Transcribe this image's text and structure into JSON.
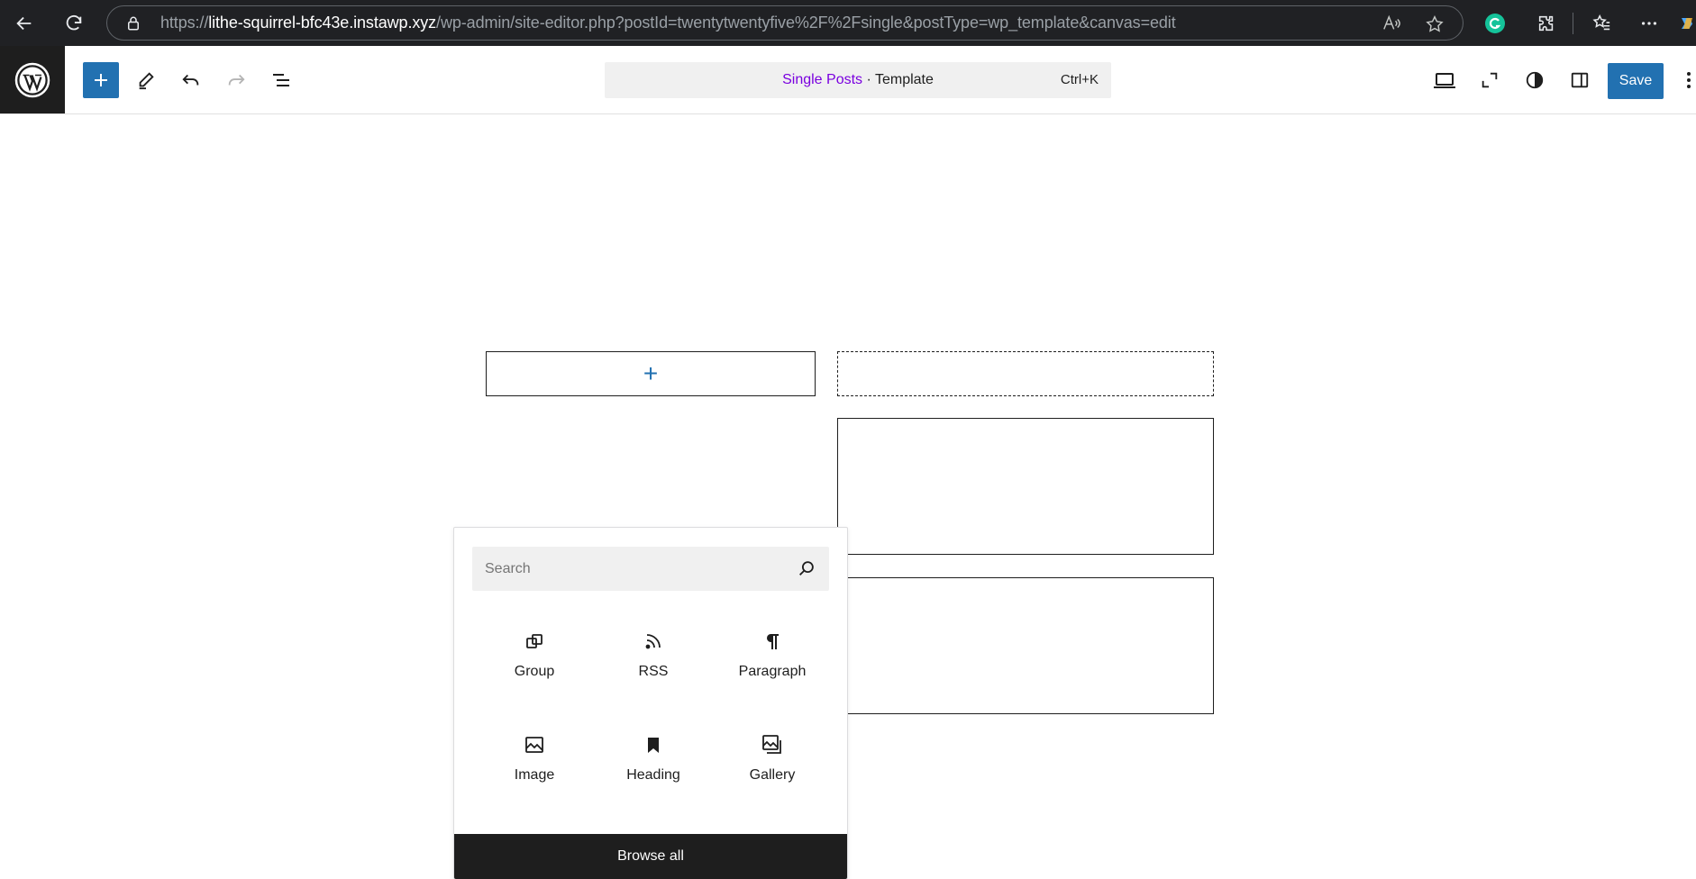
{
  "browser": {
    "url_scheme": "https://",
    "url_host": "lithe-squirrel-bfc43e.instawp.xyz",
    "url_path": "/wp-admin/site-editor.php?postId=twentytwentyfive%2F%2Fsingle&postType=wp_template&canvas=edit"
  },
  "editor": {
    "command_bar": {
      "template_name": "Single Posts",
      "separator": " · ",
      "type_label": "Template",
      "shortcut": "Ctrl+K"
    },
    "save_label": "Save"
  },
  "canvas": {
    "add_block_symbol": "+"
  },
  "inserter": {
    "search_placeholder": "Search",
    "blocks": [
      {
        "label": "Group",
        "icon": "group-icon"
      },
      {
        "label": "RSS",
        "icon": "rss-icon"
      },
      {
        "label": "Paragraph",
        "icon": "paragraph-icon"
      },
      {
        "label": "Image",
        "icon": "image-icon"
      },
      {
        "label": "Heading",
        "icon": "heading-bookmark-icon"
      },
      {
        "label": "Gallery",
        "icon": "gallery-icon"
      }
    ],
    "browse_all_label": "Browse all"
  },
  "colors": {
    "wp_blue": "#2271b1",
    "dark": "#1e1e1e",
    "template_purple": "#7a00df",
    "browser_bg": "#202124"
  }
}
